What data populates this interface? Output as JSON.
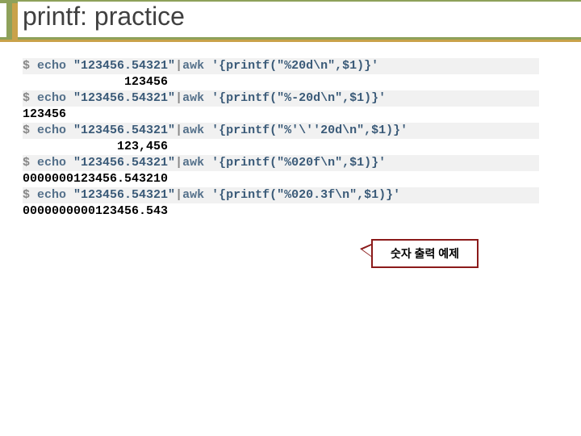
{
  "title": "printf: practice",
  "callout": "숫자 출력 예제",
  "rows": [
    {
      "prompt": "$ ",
      "cmd": "echo ",
      "arg": "\"123456.54321\"",
      "pipe": "|",
      "awk": "awk ",
      "code": "'{printf(\"%20d\\n\",$1)}'",
      "plain": ""
    },
    {
      "prompt": "",
      "cmd": "",
      "arg": "",
      "pipe": "",
      "awk": "",
      "code": "",
      "plain": "              123456"
    },
    {
      "prompt": "$ ",
      "cmd": "echo ",
      "arg": "\"123456.54321\"",
      "pipe": "|",
      "awk": "awk ",
      "code": "'{printf(\"%-20d\\n\",$1)}'",
      "plain": ""
    },
    {
      "prompt": "",
      "cmd": "",
      "arg": "",
      "pipe": "",
      "awk": "",
      "code": "",
      "plain": "123456"
    },
    {
      "prompt": "$ ",
      "cmd": "echo ",
      "arg": "\"123456.54321\"",
      "pipe": "|",
      "awk": "awk ",
      "code": "'{printf(\"%'\\''20d\\n\",$1)}'",
      "plain": ""
    },
    {
      "prompt": "",
      "cmd": "",
      "arg": "",
      "pipe": "",
      "awk": "",
      "code": "",
      "plain": "             123,456"
    },
    {
      "prompt": "$ ",
      "cmd": "echo ",
      "arg": "\"123456.54321\"",
      "pipe": "|",
      "awk": "awk ",
      "code": "'{printf(\"%020f\\n\",$1)}'",
      "plain": ""
    },
    {
      "prompt": "",
      "cmd": "",
      "arg": "",
      "pipe": "",
      "awk": "",
      "code": "",
      "plain": "0000000123456.543210"
    },
    {
      "prompt": "$ ",
      "cmd": "echo ",
      "arg": "\"123456.54321\"",
      "pipe": "|",
      "awk": "awk ",
      "code": "'{printf(\"%020.3f\\n\",$1)}'",
      "plain": ""
    },
    {
      "prompt": "",
      "cmd": "",
      "arg": "",
      "pipe": "",
      "awk": "",
      "code": "",
      "plain": "0000000000123456.543"
    }
  ]
}
